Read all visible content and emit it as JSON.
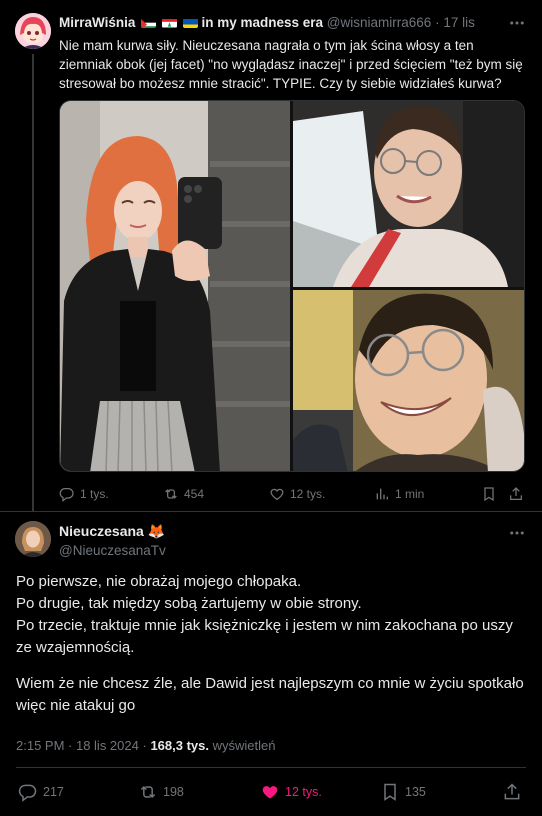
{
  "colors": {
    "like": "#f91880",
    "muted": "#71767b",
    "text": "#e7e9ea",
    "border": "#2f3336"
  },
  "parent": {
    "name": "MirraWiśnia",
    "flags": [
      "flag-palestine",
      "flag-lebanon",
      "flag-ukraine"
    ],
    "bio_suffix": "in my madness era",
    "handle": "@wisniamirra666",
    "dot": "·",
    "time": "17 lis",
    "text": "Nie mam kurwa siły. Nieuczesana nagrała o tym jak ścina włosy a ten ziemniak obok (jej facet) \"no wyglądasz inaczej\" i przed ścięciem \"też bym się stresował bo możesz mnie stracić\". TYPIE. Czy ty siebie widziałeś kurwa?",
    "actions": {
      "replies": "1 tys.",
      "reposts": "454",
      "likes": "12 tys.",
      "views": "1 min"
    }
  },
  "reply": {
    "name": "Nieuczesana",
    "name_emoji": "🦊",
    "handle": "@NieuczesanaTv",
    "lines": [
      "Po pierwsze, nie obrażaj mojego chłopaka.",
      "Po drugie, tak między sobą żartujemy w obie strony.",
      "Po trzecie, traktuje mnie jak księżniczkę i jestem w nim zakochana po uszy ze wzajemnością.",
      "Wiem że nie chcesz źle, ale Dawid jest najlepszym co mnie w życiu spotkało więc nie atakuj go"
    ],
    "meta": {
      "time": "2:15 PM · 18 lis 2024",
      "dot": "·",
      "views": "168,3 tys.",
      "views_label": "wyświetleń"
    },
    "actions": {
      "replies": "217",
      "reposts": "198",
      "likes": "12 tys.",
      "bookmarks": "135"
    }
  }
}
